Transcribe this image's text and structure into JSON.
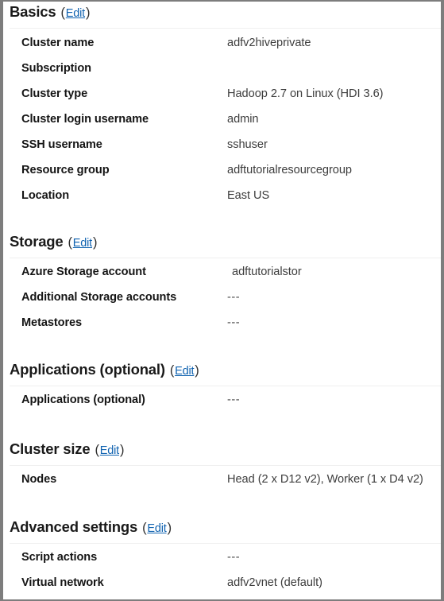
{
  "panel": {
    "name": "cluster-creation-summary",
    "edit_label": "Edit",
    "open_paren": "(",
    "close_paren": ")"
  },
  "sections": [
    {
      "id": "basics",
      "title": "Basics",
      "edit_label": "Edit",
      "rows": [
        {
          "label": "Cluster name",
          "value": "adfv2hiveprivate"
        },
        {
          "label": "Subscription",
          "value": ""
        },
        {
          "label": "Cluster type",
          "value": "Hadoop 2.7 on Linux (HDI 3.6)"
        },
        {
          "label": "Cluster login username",
          "value": "admin"
        },
        {
          "label": "SSH username",
          "value": "sshuser"
        },
        {
          "label": "Resource group",
          "value": "adftutorialresourcegroup"
        },
        {
          "label": "Location",
          "value": "East US"
        }
      ]
    },
    {
      "id": "storage",
      "title": "Storage",
      "edit_label": "Edit",
      "rows": [
        {
          "label": "Azure Storage account",
          "value": "adftutorialstor"
        },
        {
          "label": "Additional Storage accounts",
          "value": "---"
        },
        {
          "label": "Metastores",
          "value": "---"
        }
      ]
    },
    {
      "id": "applications",
      "title": "Applications (optional)",
      "edit_label": "Edit",
      "rows": [
        {
          "label": "Applications (optional)",
          "value": "---"
        }
      ]
    },
    {
      "id": "cluster-size",
      "title": "Cluster size",
      "edit_label": "Edit",
      "rows": [
        {
          "label": "Nodes",
          "value": "Head (2 x D12 v2), Worker (1 x D4 v2)"
        }
      ]
    },
    {
      "id": "advanced-settings",
      "title": "Advanced settings",
      "edit_label": "Edit",
      "rows": [
        {
          "label": "Script actions",
          "value": "---"
        },
        {
          "label": "Virtual network",
          "value": "adfv2vnet (default)"
        }
      ]
    }
  ],
  "colors": {
    "link": "#0f62b0",
    "label_text": "#151515",
    "value_text": "#3d3d3d",
    "rule": "#efefef",
    "frame": "#7d7d7d",
    "background": "#ffffff"
  }
}
